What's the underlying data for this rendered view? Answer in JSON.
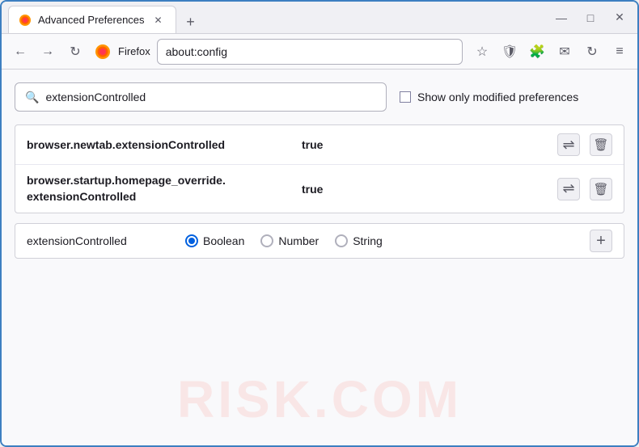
{
  "window": {
    "title": "Advanced Preferences",
    "new_tab_icon": "+",
    "controls": {
      "minimize": "—",
      "maximize": "□",
      "close": "✕"
    }
  },
  "tab": {
    "title": "Advanced Preferences",
    "close": "✕"
  },
  "navbar": {
    "back": "←",
    "forward": "→",
    "reload": "↻",
    "browser_name": "Firefox",
    "address": "about:config",
    "bookmark_icon": "☆",
    "shield_icon": "🛡",
    "extension_icon": "🧩",
    "mail_icon": "✉",
    "sync_icon": "↻",
    "menu_icon": "≡"
  },
  "search": {
    "placeholder": "extensionControlled",
    "value": "extensionControlled",
    "icon": "🔍",
    "show_modified_label": "Show only modified preferences"
  },
  "results": [
    {
      "name": "browser.newtab.extensionControlled",
      "value": "true"
    },
    {
      "name": "browser.startup.homepage_override.\nextensionControlled",
      "name_line1": "browser.startup.homepage_override.",
      "name_line2": "extensionControlled",
      "value": "true",
      "multiline": true
    }
  ],
  "add_pref": {
    "name": "extensionControlled",
    "types": [
      {
        "label": "Boolean",
        "selected": true
      },
      {
        "label": "Number",
        "selected": false
      },
      {
        "label": "String",
        "selected": false
      }
    ],
    "add_icon": "+"
  },
  "watermark": "RISK.COM",
  "colors": {
    "accent": "#0060df",
    "border": "#3d7fc1"
  }
}
